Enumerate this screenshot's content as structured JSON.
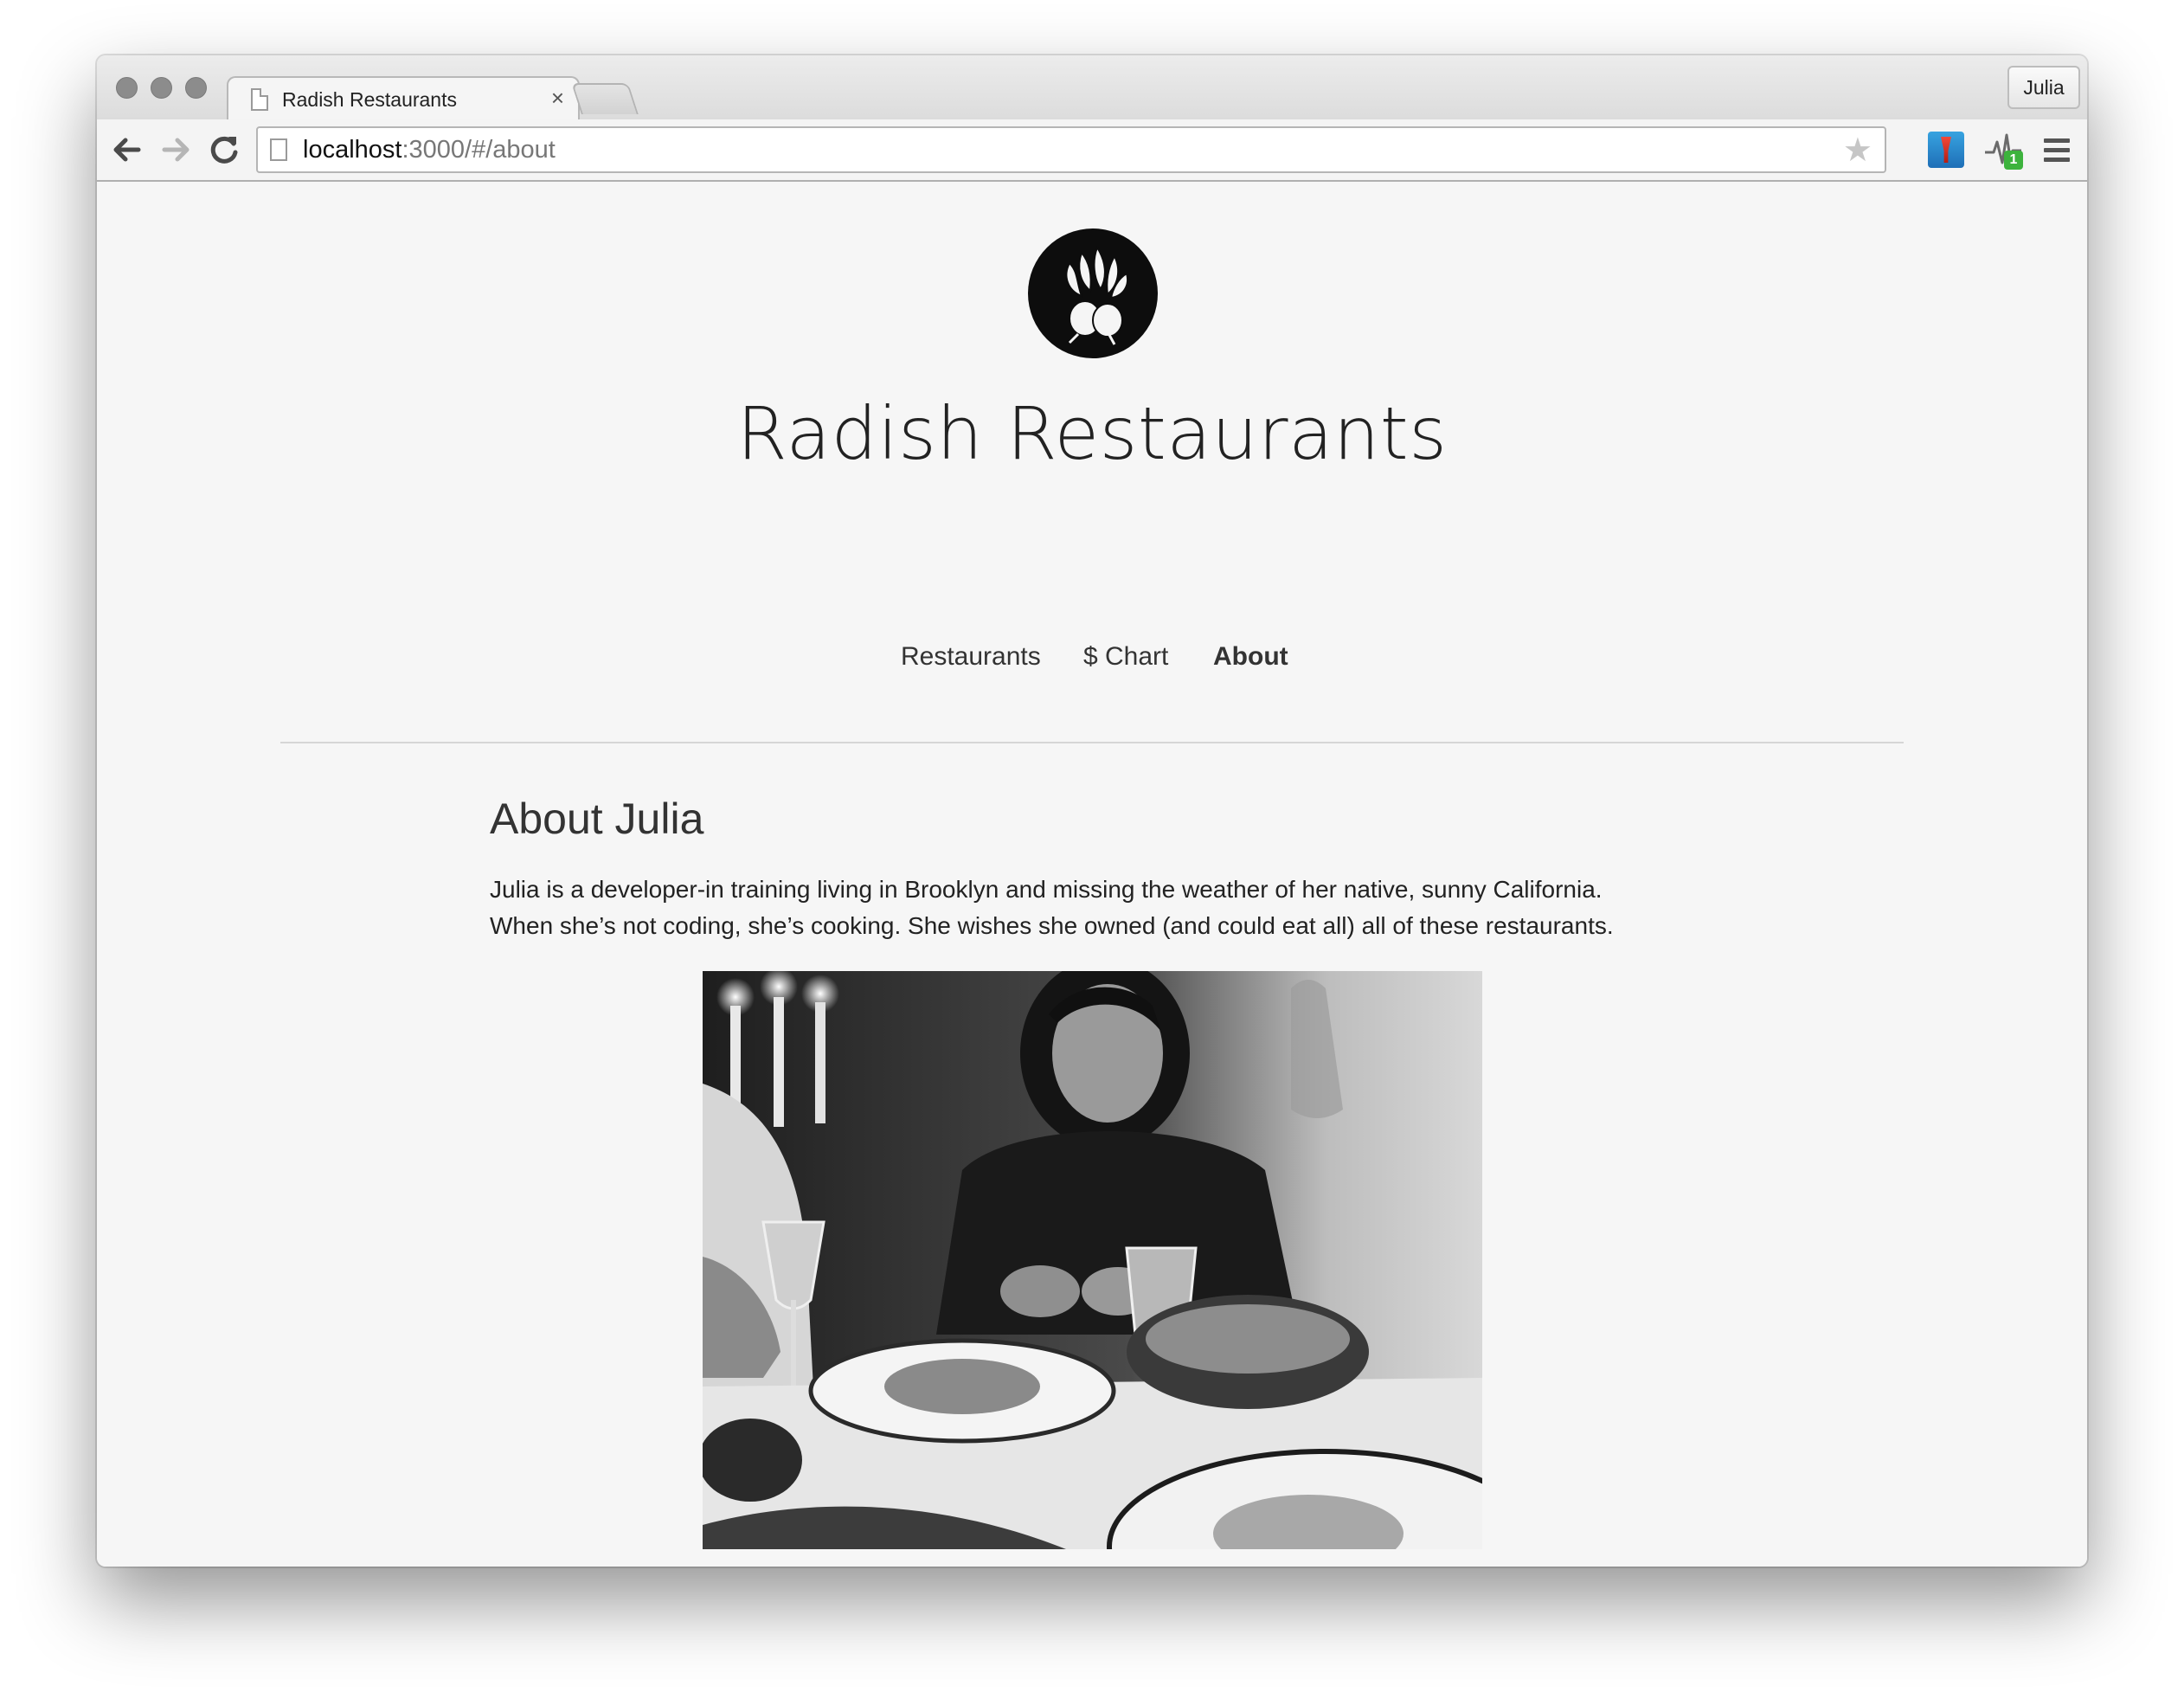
{
  "browser": {
    "tab_title": "Radish Restaurants",
    "tab_close": "×",
    "profile_name": "Julia",
    "url_host": "localhost",
    "url_path": ":3000/#/about",
    "bookmark_star": "★",
    "extension_badge": "1"
  },
  "site": {
    "title": "Radish Restaurants",
    "nav": {
      "restaurants": "Restaurants",
      "chart": "$ Chart",
      "about": "About"
    }
  },
  "about": {
    "heading": "About Julia",
    "line1": "Julia is a developer-in training living in Brooklyn and missing the weather of her native, sunny California.",
    "line2": "When she’s not coding, she’s cooking. She wishes she owned (and could eat all) all of these restaurants."
  },
  "icons": {
    "back": "back-arrow-icon",
    "forward": "forward-arrow-icon",
    "reload": "reload-icon",
    "star": "bookmark-star-icon",
    "menu": "hamburger-menu-icon",
    "logo": "radish-logo-icon"
  },
  "colors": {
    "page_background": "#f6f6f6",
    "text": "#222222",
    "badge": "#3db33d"
  }
}
